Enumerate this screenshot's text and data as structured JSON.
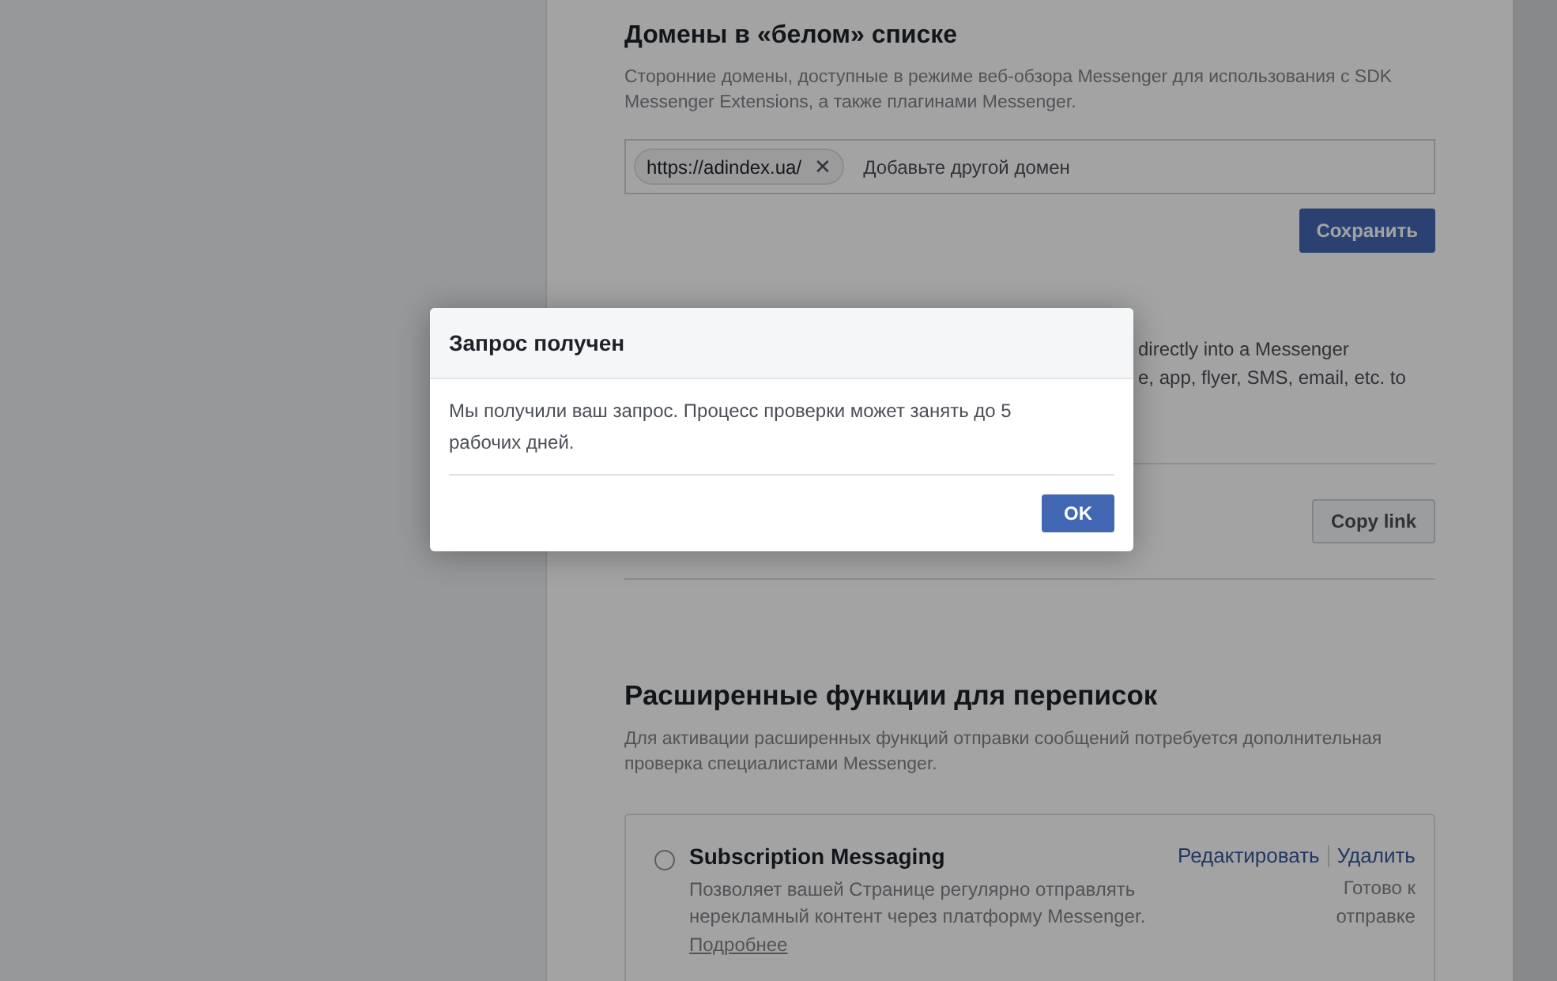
{
  "whitelist": {
    "title": "Домены в «белом» списке",
    "description": "Сторонние домены, доступные в режиме веб-обзора Messenger для использования с SDK Messenger Extensions, а также плагинами Messenger.",
    "domains": [
      {
        "label": "https://adindex.ua/",
        "remove": "✕"
      }
    ],
    "placeholder": "Добавьте другой домен",
    "save_button": "Сохранить"
  },
  "messenger_link": {
    "description_lines": [
      "directly into a Messenger",
      "e, app, flyer, SMS, email, etc. to"
    ],
    "copy_button": "Copy link"
  },
  "advanced": {
    "title": "Расширенные функции для переписок",
    "description": "Для активации расширенных функций отправки сообщений потребуется дополнительная проверка специалистами Messenger.",
    "features": [
      {
        "name": "Subscription Messaging",
        "selected": false,
        "description": "Позволяет вашей Странице регулярно отправлять нерекламный контент через платформу Messenger.",
        "more_link": "Подробнее",
        "edit_link": "Редактировать",
        "delete_link": "Удалить",
        "status": "Готово к отправке"
      }
    ]
  },
  "dialog": {
    "title": "Запрос получен",
    "message": "Мы получили ваш запрос. Процесс проверки может занять до 5 рабочих дней.",
    "ok_button": "OK"
  }
}
